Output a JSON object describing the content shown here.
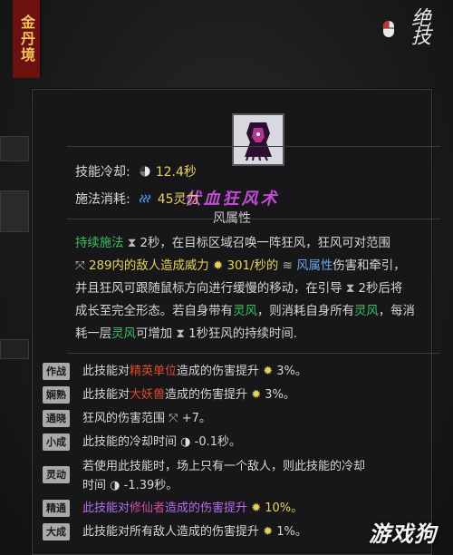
{
  "side_tag": "金丹境",
  "brand": "绝技",
  "skill": {
    "title": "伏血狂风术",
    "attribute": "风属性",
    "cooldown_label": "技能冷却:",
    "cooldown_value": "12.4秒",
    "cost_label": "施法消耗:",
    "cost_value": "45灵力"
  },
  "description": {
    "p1": "持续施法",
    "p2": "2秒，在目标区域召唤一阵狂风，狂风可对范围",
    "p3": "289内的敌人造成威力",
    "p4": "301/秒的",
    "p5": "风属性",
    "p6": "伤害和牵引，",
    "p7": "并且狂风可跟随鼠标方向进行缓慢的移动，在引导",
    "p8": "2秒后将",
    "p9": "成长至完全形态。若自身带有",
    "p10": "灵风",
    "p11": "，则消耗自身所有",
    "p12": "灵风",
    "p13": "，每消",
    "p14": "耗一层",
    "p15": "灵风",
    "p16": "可增加",
    "p17": "1秒狂风的持续时间."
  },
  "upgrades": [
    {
      "badge": "作战",
      "a": "此技能对",
      "hl": "精英单位",
      "b": "造成的伤害提升",
      "val": "3%。"
    },
    {
      "badge": "娴熟",
      "a": "此技能对",
      "hl": "大妖兽",
      "b": "造成的伤害提升",
      "val": "3%。"
    },
    {
      "badge": "通晓",
      "a": "狂风的伤害范围",
      "val": "+7。"
    },
    {
      "badge": "小成",
      "a": "此技能的冷却时间",
      "val": "-0.1秒。"
    },
    {
      "badge": "灵动",
      "a": "若使用此技能时，场上只有一个敌人，则此技能的冷却",
      "a2": "时间",
      "val": "-1.39秒。"
    },
    {
      "badge": "精通",
      "a": "此技能对",
      "hl": "修仙者",
      "b": "造成的伤害提升",
      "val": "10%。"
    },
    {
      "badge": "大成",
      "a": "此技能对",
      "hl": "所有敌人",
      "b": "造成的伤害提升",
      "val": "1%。"
    }
  ],
  "watermark": "游戏狗",
  "colors": {
    "title": "#c24bd6",
    "value": "#e8d35a",
    "green": "#39c060",
    "blue": "#6aa8ee",
    "red": "#e04a2a",
    "pink": "#d34aa8",
    "purple": "#b66bf0"
  }
}
